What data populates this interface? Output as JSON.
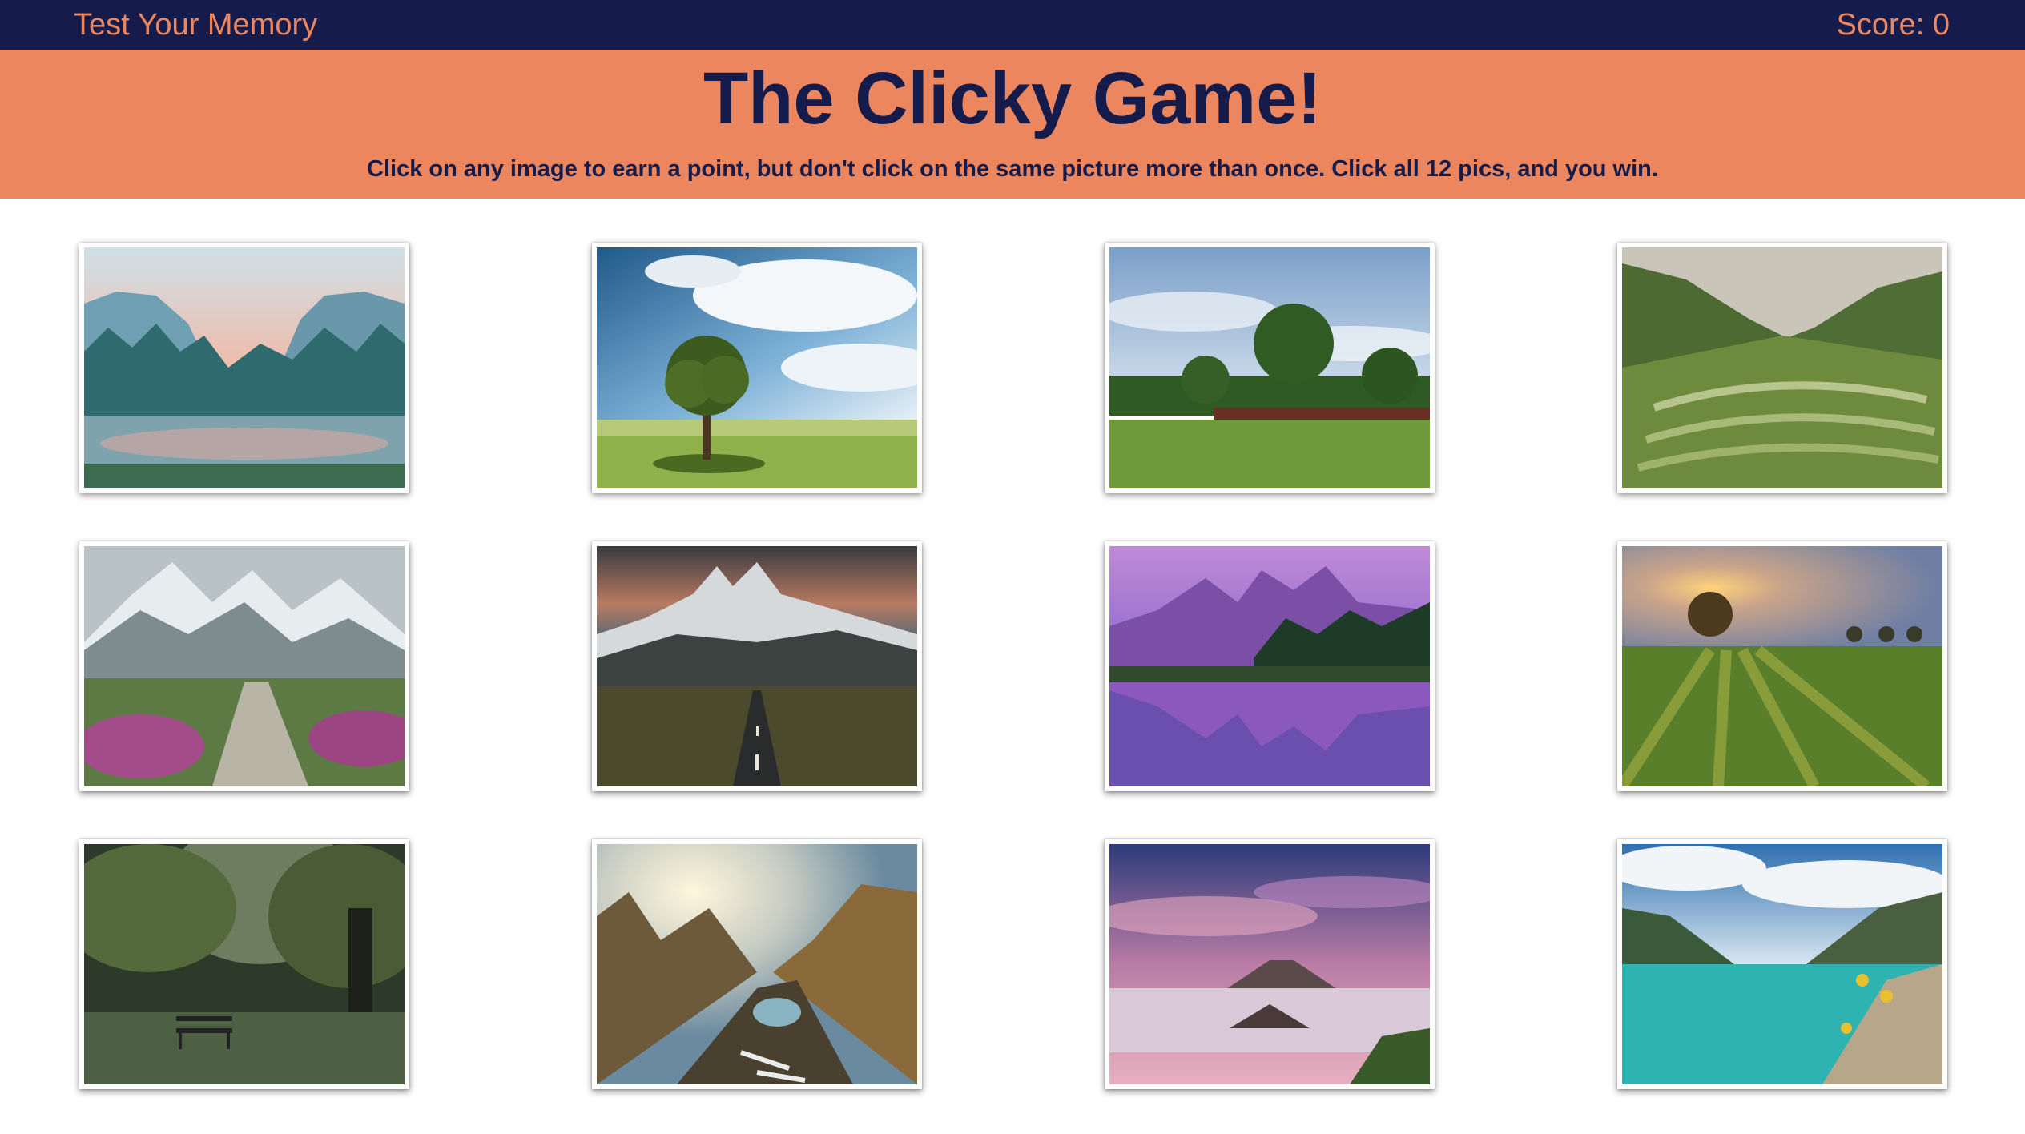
{
  "navbar": {
    "title": "Test Your Memory",
    "score": "Score: 0"
  },
  "header": {
    "title": "The Clicky Game!",
    "instructions": "Click on any image to earn a point, but don't click on the same picture more than once. Click all 12 pics, and you win."
  },
  "colors": {
    "navbar_bg": "#151c4b",
    "accent": "#ec865f",
    "text_dark": "#151c4b"
  },
  "images": [
    {
      "name": "yosemite-valley-river-image"
    },
    {
      "name": "lone-tree-field-image"
    },
    {
      "name": "green-meadow-tree-image"
    },
    {
      "name": "rice-terraces-valley-image"
    },
    {
      "name": "mountain-stone-path-image"
    },
    {
      "name": "mountain-road-image"
    },
    {
      "name": "purple-lake-reflection-image"
    },
    {
      "name": "sunset-tree-field-image"
    },
    {
      "name": "park-bench-trees-image"
    },
    {
      "name": "mountain-sunrise-lake-image"
    },
    {
      "name": "volcano-fog-sunrise-image"
    },
    {
      "name": "turquoise-lake-mountains-image"
    }
  ]
}
